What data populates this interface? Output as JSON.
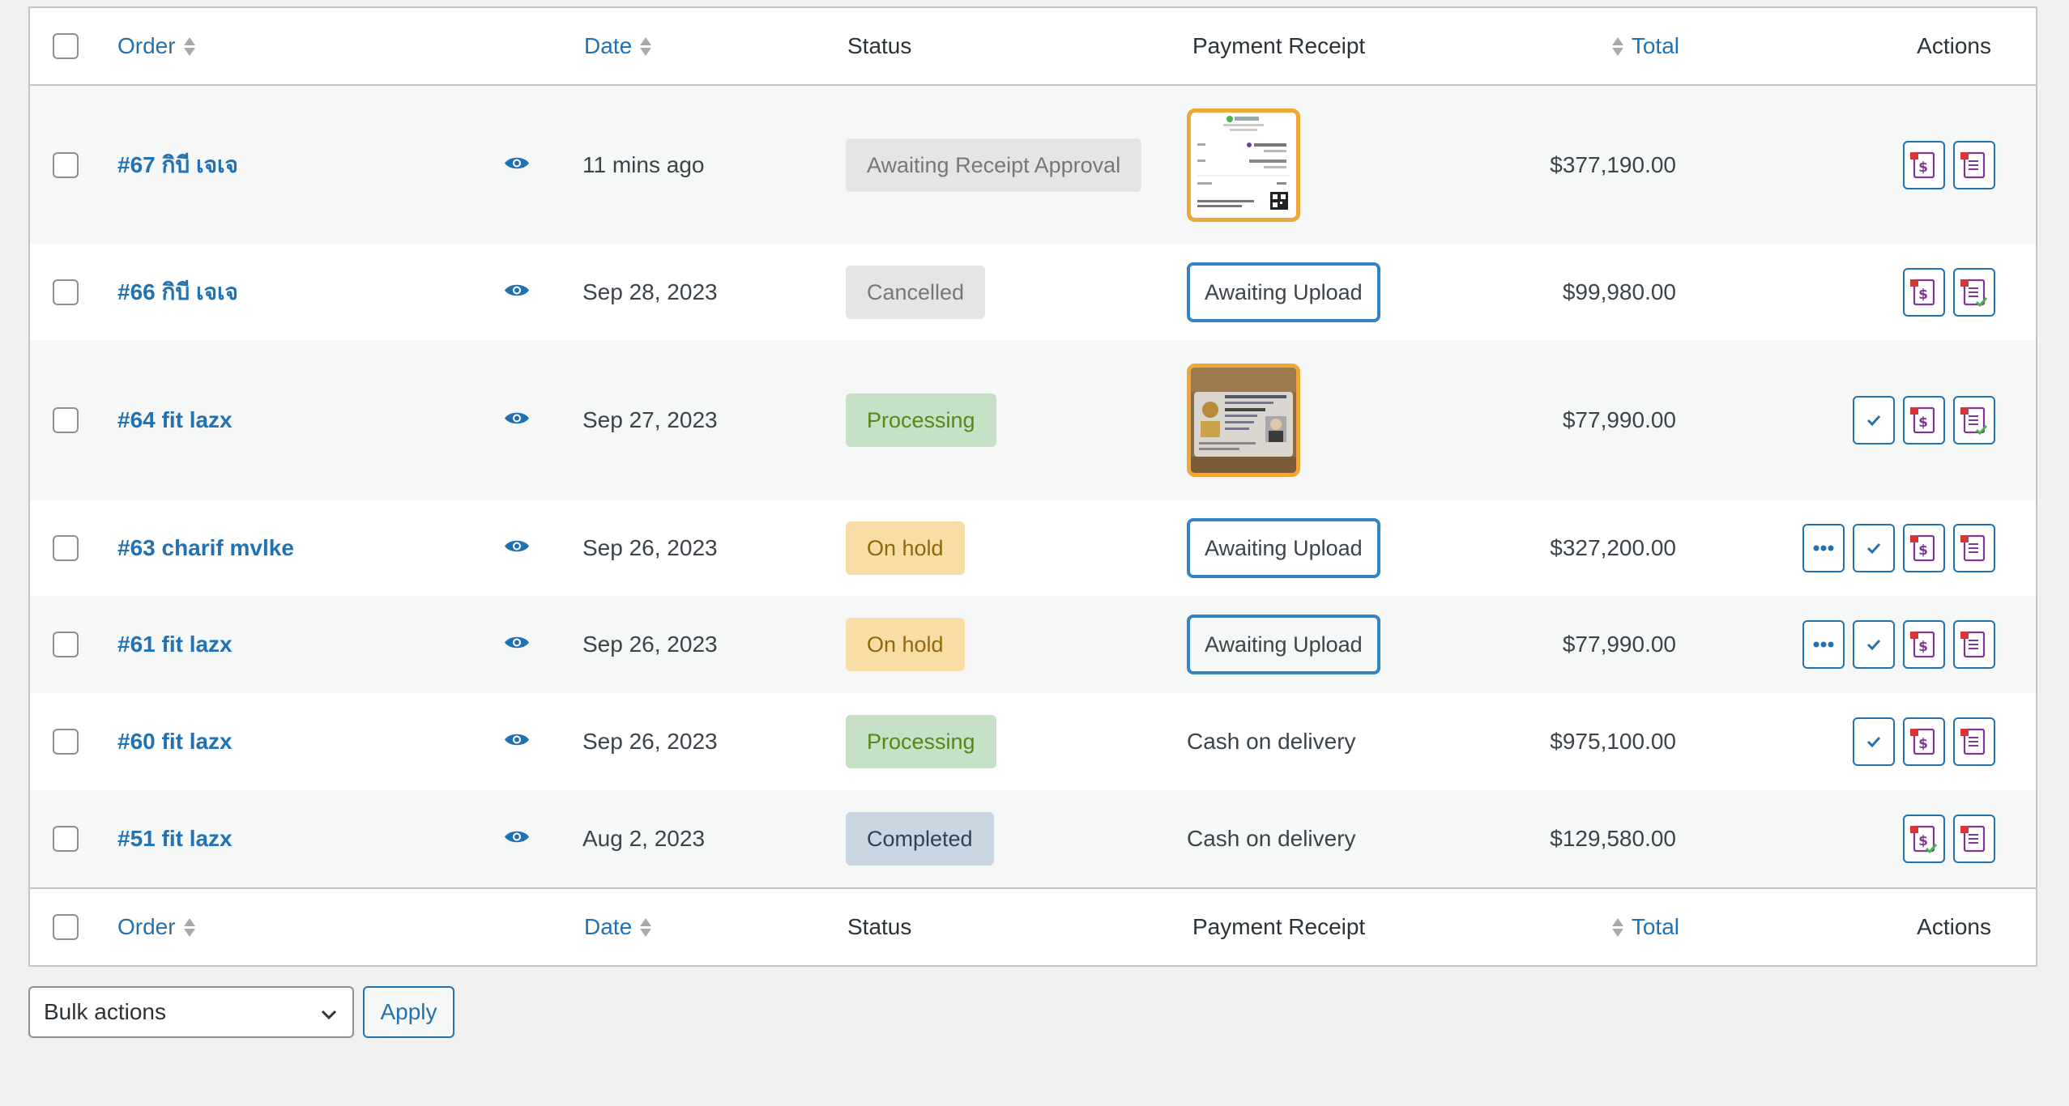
{
  "columns": {
    "order": "Order",
    "date": "Date",
    "status": "Status",
    "payment_receipt": "Payment Receipt",
    "total": "Total",
    "actions": "Actions"
  },
  "orders": [
    {
      "order": "#67 กิบี เจเจ",
      "date": "11 mins ago",
      "status": "Awaiting Receipt Approval",
      "status_class": "awaiting",
      "receipt_type": "receipt-image",
      "total": "$377,190.00",
      "actions": [
        "invoice",
        "packing-slip"
      ]
    },
    {
      "order": "#66 กิบี เจเจ",
      "date": "Sep 28, 2023",
      "status": "Cancelled",
      "status_class": "cancelled",
      "receipt_type": "upload",
      "receipt_text": "Awaiting Upload",
      "total": "$99,980.00",
      "actions": [
        "invoice",
        "packing-slip-done"
      ]
    },
    {
      "order": "#64 fit lazx",
      "date": "Sep 27, 2023",
      "status": "Processing",
      "status_class": "processing",
      "receipt_type": "id-image",
      "total": "$77,990.00",
      "actions": [
        "complete",
        "invoice",
        "packing-slip-done"
      ]
    },
    {
      "order": "#63 charif mvlke",
      "date": "Sep 26, 2023",
      "status": "On hold",
      "status_class": "onhold",
      "receipt_type": "upload",
      "receipt_text": "Awaiting Upload",
      "total": "$327,200.00",
      "actions": [
        "processing",
        "complete",
        "invoice",
        "packing-slip"
      ]
    },
    {
      "order": "#61 fit lazx",
      "date": "Sep 26, 2023",
      "status": "On hold",
      "status_class": "onhold",
      "receipt_type": "upload",
      "receipt_text": "Awaiting Upload",
      "total": "$77,990.00",
      "actions": [
        "processing",
        "complete",
        "invoice",
        "packing-slip"
      ]
    },
    {
      "order": "#60 fit lazx",
      "date": "Sep 26, 2023",
      "status": "Processing",
      "status_class": "processing",
      "receipt_type": "text",
      "receipt_text": "Cash on delivery",
      "total": "$975,100.00",
      "actions": [
        "complete",
        "invoice",
        "packing-slip"
      ]
    },
    {
      "order": "#51 fit lazx",
      "date": "Aug 2, 2023",
      "status": "Completed",
      "status_class": "completed",
      "receipt_type": "text",
      "receipt_text": "Cash on delivery",
      "total": "$129,580.00",
      "actions": [
        "invoice-done",
        "packing-slip"
      ]
    }
  ],
  "bulk": {
    "select_label": "Bulk actions",
    "apply_label": "Apply"
  },
  "colors": {
    "link": "#2271b1",
    "thumb_border": "#f0a73a",
    "upload_border": "#3582c4",
    "pdf_red": "#d63638",
    "pdf_purple": "#7e3794",
    "done_green": "#46b450"
  }
}
